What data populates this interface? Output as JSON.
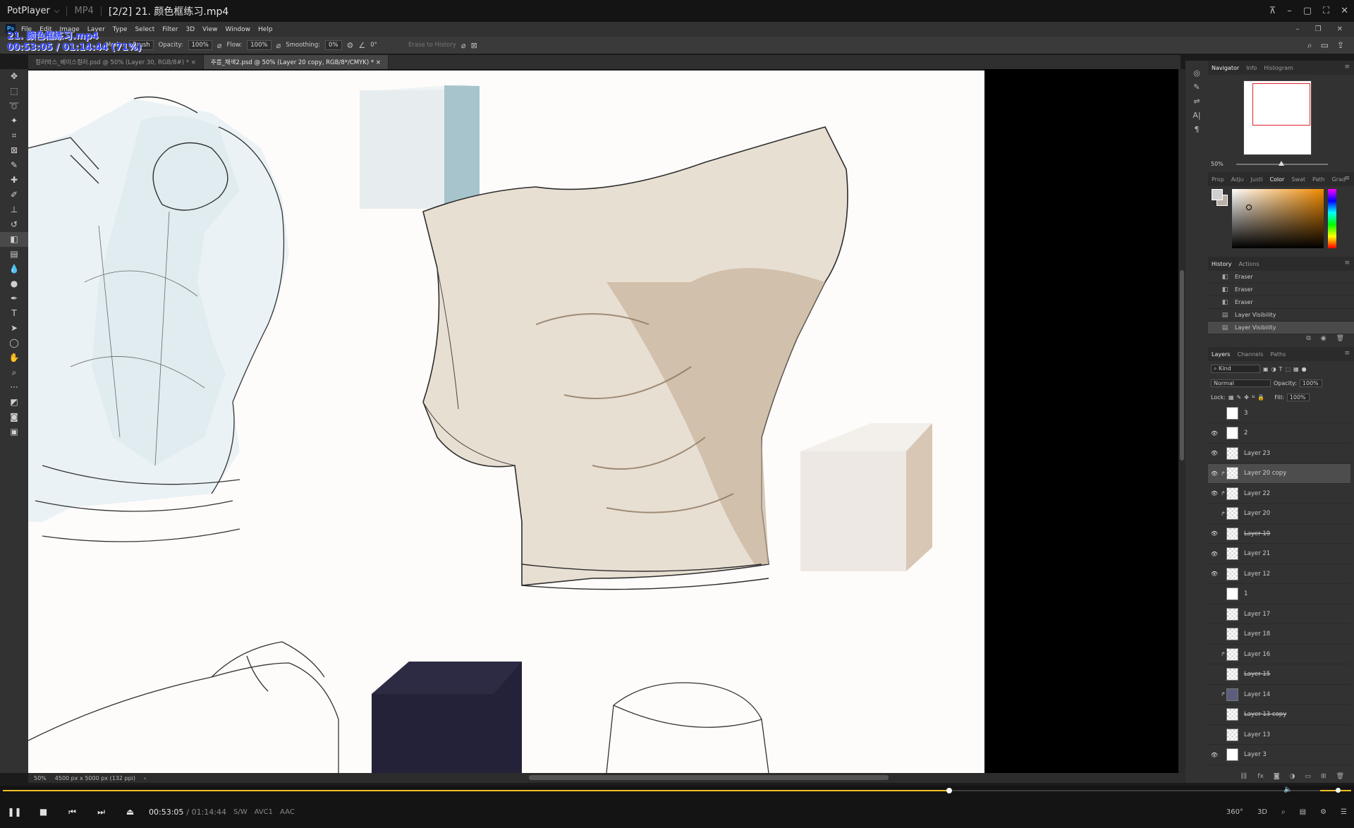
{
  "potplayer": {
    "app_name": "PotPlayer",
    "format": "MP4",
    "file_title": "[2/2] 21. 颜色框练习.mp4",
    "osd_filename": "21. 颜色框练习.mp4",
    "osd_time": "00:53:05 / 01:14:44 (71%)",
    "current_time": "00:53:05",
    "total_time": "/ 01:14:44",
    "tag_sw": "S/W",
    "tag_video": "AVC1",
    "tag_audio": "AAC",
    "right_360": "360°",
    "right_3d": "3D",
    "seek_progress": 0.71
  },
  "photoshop": {
    "menu": [
      "File",
      "Edit",
      "Image",
      "Layer",
      "Type",
      "Select",
      "Filter",
      "3D",
      "View",
      "Window",
      "Help"
    ],
    "options": {
      "mode_label": "Mode:",
      "mode_value": "Brush",
      "opacity_label": "Opacity:",
      "opacity_value": "100%",
      "flow_label": "Flow:",
      "flow_value": "100%",
      "smoothing_label": "Smoothing:",
      "smoothing_value": "0%",
      "angle_value": "0°",
      "erase_history": "Erase to History"
    },
    "tabs": [
      "컬러박스_베이스컬러.psd @ 50% (Layer 30, RGB/8#) *",
      "주름_채색2.psd @ 50% (Layer 20 copy, RGB/8*/CMYK) *"
    ],
    "status": {
      "zoom": "50%",
      "doc_size": "4500 px x 5000 px (132 ppi)"
    },
    "navigator": {
      "tabs": [
        "Navigator",
        "Info",
        "Histogram"
      ],
      "zoom": "50%"
    },
    "color_panel": {
      "tabs": [
        "Prop",
        "Adju",
        "Justi",
        "Color",
        "Swat",
        "Path",
        "Grad"
      ]
    },
    "history": {
      "tabs": [
        "History",
        "Actions"
      ],
      "items": [
        "Eraser",
        "Eraser",
        "Eraser",
        "Layer Visibility",
        "Layer Visibility"
      ]
    },
    "layers_panel": {
      "tabs": [
        "Layers",
        "Channels",
        "Paths"
      ],
      "kind_label": "Kind",
      "blend_mode": "Normal",
      "opacity_label": "Opacity:",
      "opacity_value": "100%",
      "lock_label": "Lock:",
      "fill_label": "Fill:",
      "fill_value": "100%",
      "layers": [
        {
          "name": "3",
          "visible": false,
          "thumb": "solid",
          "clipped": false,
          "strike": false
        },
        {
          "name": "2",
          "visible": true,
          "thumb": "solid",
          "clipped": false,
          "strike": false
        },
        {
          "name": "Layer 23",
          "visible": true,
          "thumb": "checker",
          "clipped": false,
          "strike": false
        },
        {
          "name": "Layer 20 copy",
          "visible": true,
          "thumb": "checker",
          "clipped": true,
          "strike": false,
          "selected": true
        },
        {
          "name": "Layer 22",
          "visible": true,
          "thumb": "checker",
          "clipped": true,
          "strike": false
        },
        {
          "name": "Layer 20",
          "visible": false,
          "thumb": "checker",
          "clipped": true,
          "strike": false
        },
        {
          "name": "Layer 19",
          "visible": true,
          "thumb": "checker",
          "clipped": false,
          "strike": true
        },
        {
          "name": "Layer 21",
          "visible": true,
          "thumb": "checker",
          "clipped": false,
          "strike": false
        },
        {
          "name": "Layer 12",
          "visible": true,
          "thumb": "checker",
          "clipped": false,
          "strike": false
        },
        {
          "name": "1",
          "visible": false,
          "thumb": "solid",
          "clipped": false,
          "strike": false
        },
        {
          "name": "Layer 17",
          "visible": false,
          "thumb": "checker",
          "clipped": false,
          "strike": false
        },
        {
          "name": "Layer 18",
          "visible": false,
          "thumb": "checker",
          "clipped": false,
          "strike": false
        },
        {
          "name": "Layer 16",
          "visible": false,
          "thumb": "checker",
          "clipped": true,
          "strike": false
        },
        {
          "name": "Layer 15",
          "visible": false,
          "thumb": "checker",
          "clipped": false,
          "strike": true
        },
        {
          "name": "Layer 14",
          "visible": false,
          "thumb": "purple",
          "clipped": true,
          "strike": false
        },
        {
          "name": "Layer 13 copy",
          "visible": false,
          "thumb": "checker",
          "clipped": false,
          "strike": true
        },
        {
          "name": "Layer 13",
          "visible": false,
          "thumb": "checker",
          "clipped": false,
          "strike": false
        },
        {
          "name": "Layer 3",
          "visible": true,
          "thumb": "solid",
          "clipped": false,
          "strike": false
        }
      ]
    }
  },
  "colors": {
    "seek_accent": "#f0c020",
    "box_blue_side": "#a7c4cc",
    "box_tan_side": "#d8c7b5",
    "box_dark": "#242238",
    "shirt_beige": "#e6ddd2"
  }
}
